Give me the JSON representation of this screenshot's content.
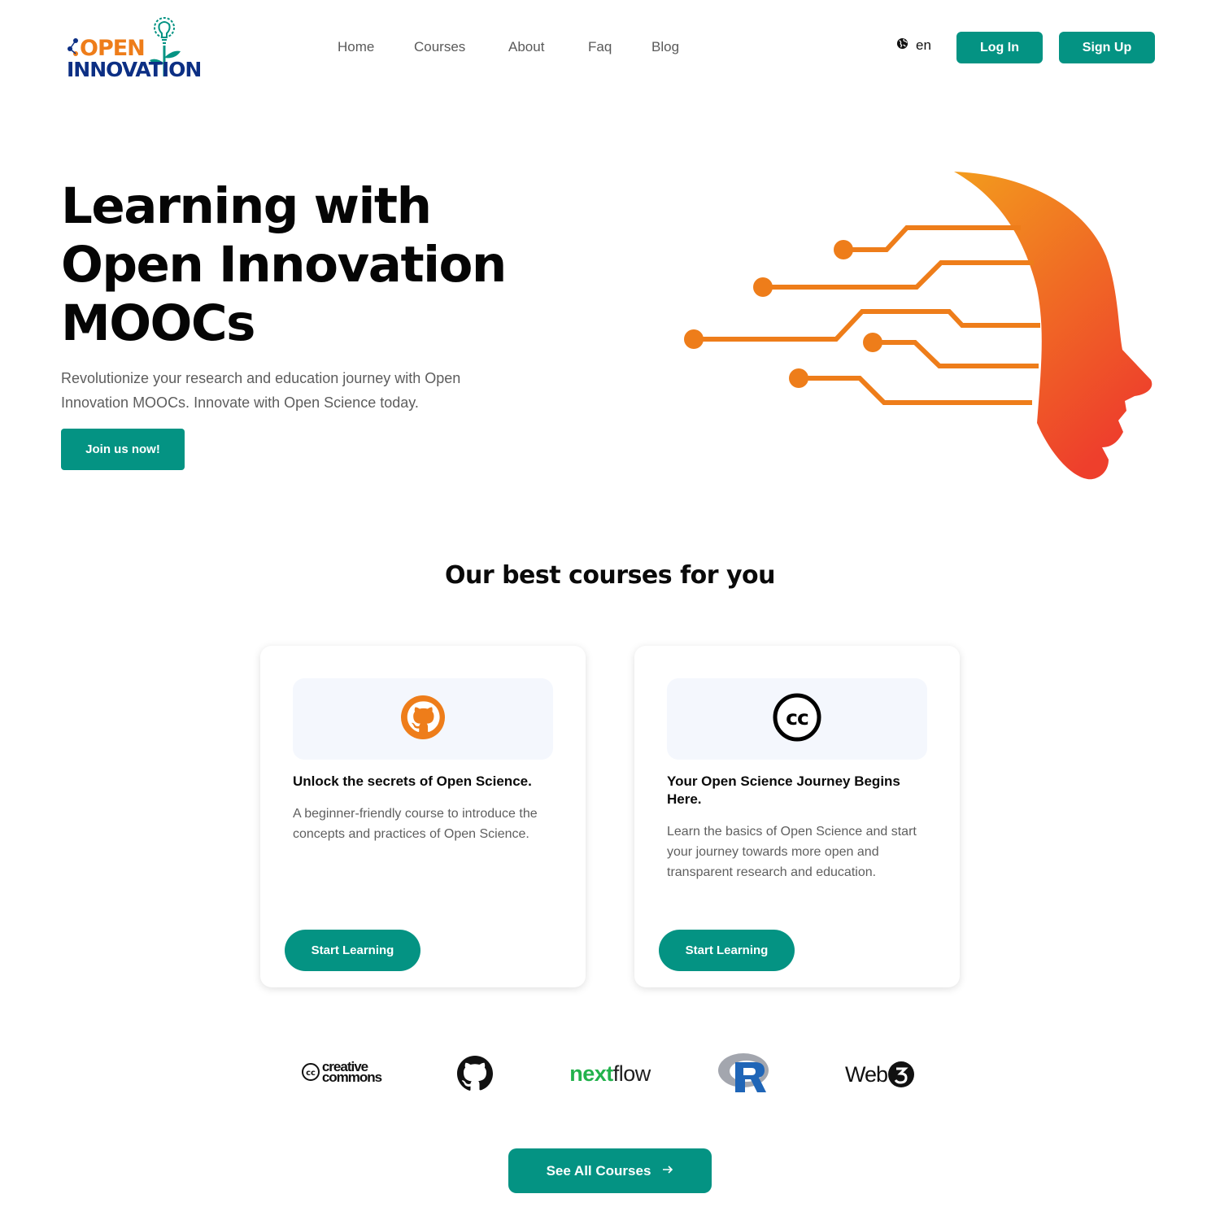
{
  "brand": {
    "logo_line1": "OPEN",
    "logo_line2": "INNOVATION",
    "accent": "#049383",
    "orange": "#ee7d1a",
    "navy": "#0c2f84"
  },
  "nav": {
    "items": [
      {
        "label": "Home"
      },
      {
        "label": "Courses"
      },
      {
        "label": "About"
      },
      {
        "label": "Faq"
      },
      {
        "label": "Blog"
      }
    ],
    "language": "en",
    "login_label": "Log In",
    "signup_label": "Sign Up"
  },
  "hero": {
    "title_line1": "Learning with",
    "title_line2": "Open Innovation",
    "title_line3": "MOOCs",
    "subtitle": "Revolutionize your research and education journey with Open Innovation MOOCs. Innovate with Open Science today.",
    "cta_label": "Join us now!"
  },
  "courses": {
    "section_title": "Our best courses for you",
    "cards": [
      {
        "icon": "github-icon",
        "title": "Unlock the secrets of Open Science.",
        "description": "A beginner-friendly course to introduce the concepts and practices of Open Science.",
        "button_label": "Start Learning"
      },
      {
        "icon": "creative-commons-icon",
        "title": "Your Open Science Journey Begins Here.",
        "description": "Learn the basics of Open Science and start your journey towards more open and transparent research and education.",
        "button_label": "Start Learning"
      }
    ]
  },
  "partners": {
    "cc_line1": "creative",
    "cc_line2": "commons",
    "nextflow_a": "next",
    "nextflow_b": "flow",
    "web3": "Web"
  },
  "footer_cta": {
    "label": "See All Courses"
  }
}
